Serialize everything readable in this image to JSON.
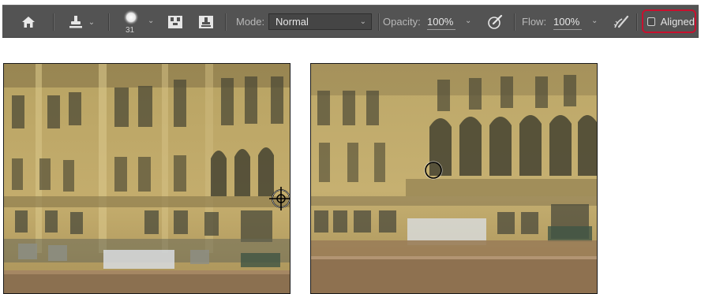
{
  "toolbar": {
    "home_icon": "home-icon",
    "tool_icon": "clone-stamp-icon",
    "brush_size": "31",
    "mode_label": "Mode:",
    "mode_value": "Normal",
    "opacity_label": "Opacity:",
    "opacity_value": "100%",
    "flow_label": "Flow:",
    "flow_value": "100%",
    "aligned_label": "Aligned",
    "aligned_checked": false
  },
  "colors": {
    "highlight_border": "#c8102e",
    "bar_background": "#535353"
  },
  "panels": {
    "left": {
      "content": "photo-of-building-facade",
      "cursor": "clone-source-crosshair-icon"
    },
    "right": {
      "content": "photo-of-building-facade-zoomed",
      "cursor": "brush-circle-cursor-icon"
    }
  }
}
